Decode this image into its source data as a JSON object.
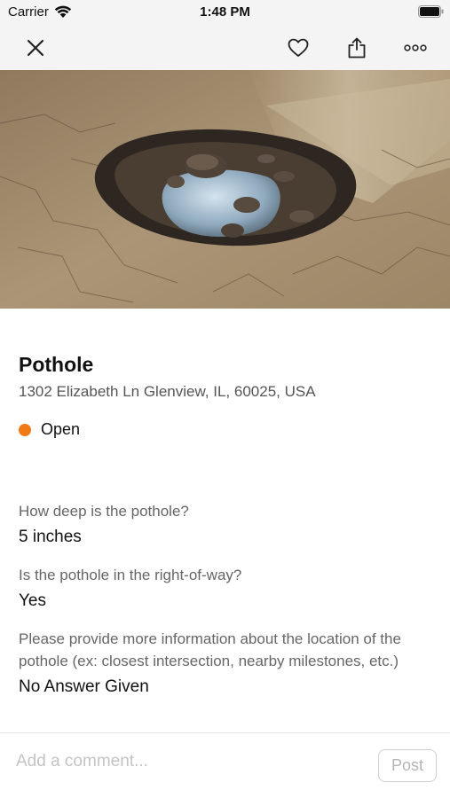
{
  "status_bar": {
    "carrier": "Carrier",
    "time": "1:48 PM"
  },
  "nav": {
    "icons": [
      "close-icon",
      "heart-icon",
      "share-icon",
      "more-icon"
    ]
  },
  "report": {
    "title": "Pothole",
    "address": "1302 Elizabeth Ln Glenview, IL, 60025, USA",
    "status": "Open",
    "status_color": "#f07a16"
  },
  "qa": [
    {
      "question": "How deep is the pothole?",
      "answer": "5 inches"
    },
    {
      "question": "Is the pothole in the right-of-way?",
      "answer": "Yes"
    },
    {
      "question": "Please provide more information about the location of the pothole (ex: closest intersection, nearby milestones, etc.)",
      "answer": "No Answer Given"
    }
  ],
  "comment": {
    "placeholder": "Add a comment...",
    "post_label": "Post"
  }
}
